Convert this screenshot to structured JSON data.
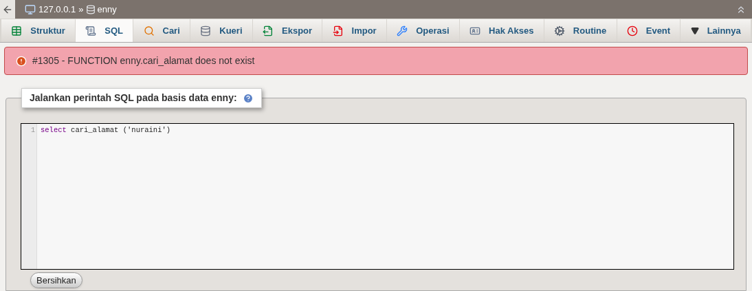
{
  "breadcrumb": {
    "server": "127.0.0.1",
    "separator": "»",
    "database": "enny"
  },
  "tabs": [
    {
      "label": "Struktur",
      "kind": "structure",
      "selected": false
    },
    {
      "label": "SQL",
      "kind": "sql",
      "selected": true
    },
    {
      "label": "Cari",
      "kind": "search",
      "selected": false
    },
    {
      "label": "Kueri",
      "kind": "query",
      "selected": false
    },
    {
      "label": "Ekspor",
      "kind": "export",
      "selected": false
    },
    {
      "label": "Impor",
      "kind": "import",
      "selected": false
    },
    {
      "label": "Operasi",
      "kind": "operations",
      "selected": false
    },
    {
      "label": "Hak Akses",
      "kind": "privileges",
      "selected": false
    },
    {
      "label": "Routine",
      "kind": "routines",
      "selected": false
    },
    {
      "label": "Event",
      "kind": "events",
      "selected": false
    },
    {
      "label": "Lainnya",
      "kind": "more",
      "selected": false
    }
  ],
  "error": {
    "message": "#1305 - FUNCTION enny.cari_alamat does not exist"
  },
  "sql_panel": {
    "legend": "Jalankan perintah SQL pada basis data enny:",
    "lines": [
      {
        "number": "1",
        "keyword": "select",
        "rest": " cari_alamat ('nuraini')"
      }
    ],
    "clear_button": "Bersihkan"
  }
}
